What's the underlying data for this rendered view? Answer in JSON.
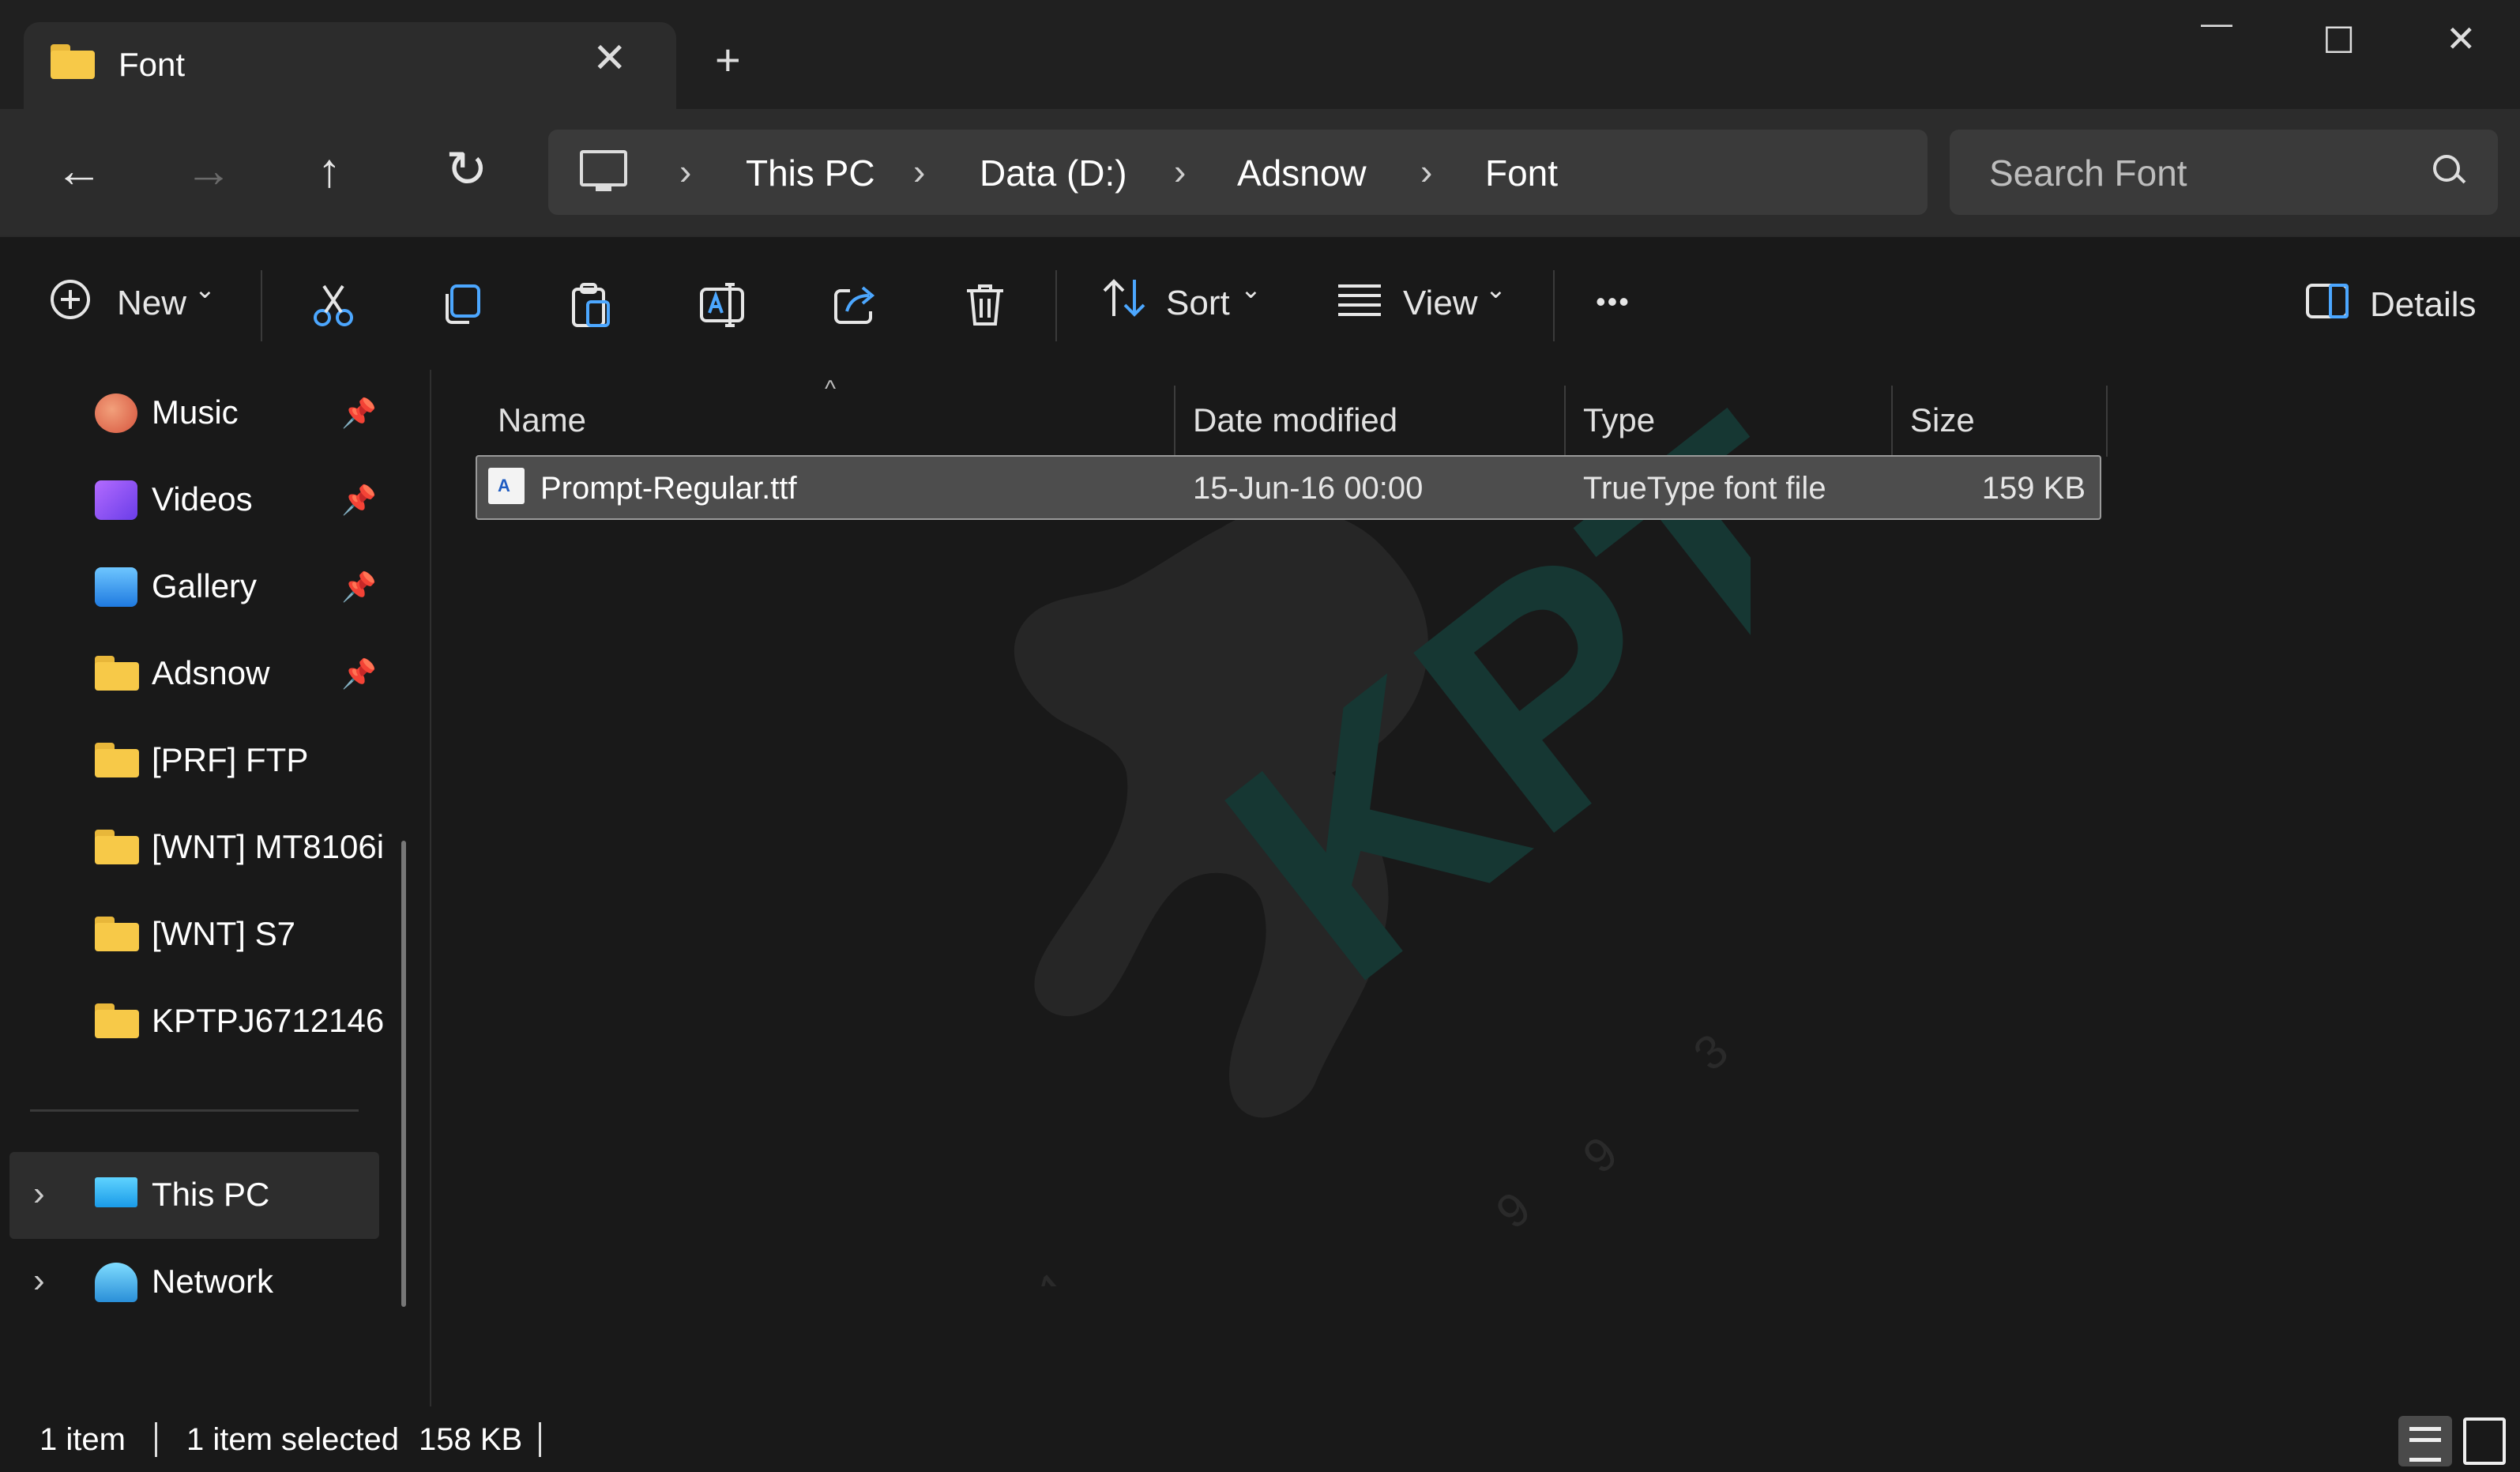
{
  "window": {
    "tab_title": "Font",
    "tab_close": "✕",
    "new_tab": "+",
    "controls": {
      "minimize": "—",
      "maximize": "☐",
      "close": "✕"
    }
  },
  "nav": {
    "back": "←",
    "forward": "→",
    "up": "↑",
    "refresh": "↻",
    "breadcrumb": [
      "This PC",
      "Data (D:)",
      "Adsnow",
      "Font"
    ],
    "chevron": "›",
    "search_placeholder": "Search Font"
  },
  "toolbar": {
    "new_label": "New",
    "sort_label": "Sort",
    "view_label": "View",
    "more_label": "•••",
    "details_label": "Details",
    "dropdown_caret": "⌄"
  },
  "sidebar": {
    "quick_access": [
      {
        "label": "Music",
        "icon": "music-icon",
        "pinned": true
      },
      {
        "label": "Videos",
        "icon": "videos-icon",
        "pinned": true
      },
      {
        "label": "Gallery",
        "icon": "gallery-icon",
        "pinned": true
      },
      {
        "label": "Adsnow",
        "icon": "folder-icon",
        "pinned": true
      },
      {
        "label": "[PRF] FTP",
        "icon": "folder-icon",
        "pinned": false
      },
      {
        "label": "[WNT] MT8106i",
        "icon": "folder-icon",
        "pinned": false
      },
      {
        "label": "[WNT] S7",
        "icon": "folder-icon",
        "pinned": false
      },
      {
        "label": "KPTPJ6712146",
        "icon": "folder-icon",
        "pinned": false
      }
    ],
    "pin_glyph": "📌",
    "expand_glyph": "›",
    "this_pc": "This PC",
    "network": "Network"
  },
  "columns": {
    "name": "Name",
    "date": "Date modified",
    "type": "Type",
    "size": "Size"
  },
  "files": [
    {
      "name": "Prompt-Regular.ttf",
      "date": "15-Jun-16 00:00",
      "type": "TrueType font file",
      "size": "159 KB",
      "selected": true
    }
  ],
  "watermark": {
    "text": "KPT",
    "digits": [
      "1",
      "9",
      "9",
      "3"
    ]
  },
  "status": {
    "item_count": "1 item",
    "selected": "1 item selected",
    "selected_size": "158 KB"
  },
  "colors": {
    "background": "#191919",
    "accent": "#4ca7ff",
    "folder": "#f7c948",
    "selection": "#4d4d4d"
  }
}
